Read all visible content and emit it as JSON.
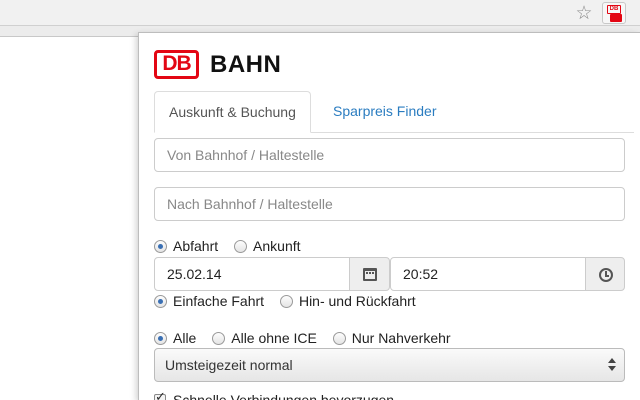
{
  "browser": {
    "bookmark_icon": "star-icon",
    "extension_icon": "db-extension-icon"
  },
  "brand": {
    "logo_mark": "DB",
    "logo_text": "BAHN",
    "color": "#e30613"
  },
  "tabs": [
    {
      "label": "Auskunft & Buchung",
      "active": true
    },
    {
      "label": "Sparpreis Finder",
      "active": false
    }
  ],
  "from": {
    "placeholder": "Von Bahnhof / Haltestelle",
    "value": ""
  },
  "to": {
    "placeholder": "Nach Bahnhof / Haltestelle",
    "value": ""
  },
  "time_mode": {
    "options": [
      {
        "label": "Abfahrt",
        "checked": true
      },
      {
        "label": "Ankunft",
        "checked": false
      }
    ]
  },
  "date": {
    "value": "25.02.14",
    "icon": "calendar-icon"
  },
  "time": {
    "value": "20:52",
    "icon": "clock-icon"
  },
  "trip_type": {
    "options": [
      {
        "label": "Einfache Fahrt",
        "checked": true
      },
      {
        "label": "Hin- und Rückfahrt",
        "checked": false
      }
    ]
  },
  "train_types": {
    "options": [
      {
        "label": "Alle",
        "checked": true
      },
      {
        "label": "Alle ohne ICE",
        "checked": false
      },
      {
        "label": "Nur Nahverkehr",
        "checked": false
      }
    ]
  },
  "transfer_time": {
    "selected": "Umsteigezeit normal"
  },
  "fast_connections": {
    "label": "Schnelle Verbindungen bevorzugen",
    "checked": true
  }
}
